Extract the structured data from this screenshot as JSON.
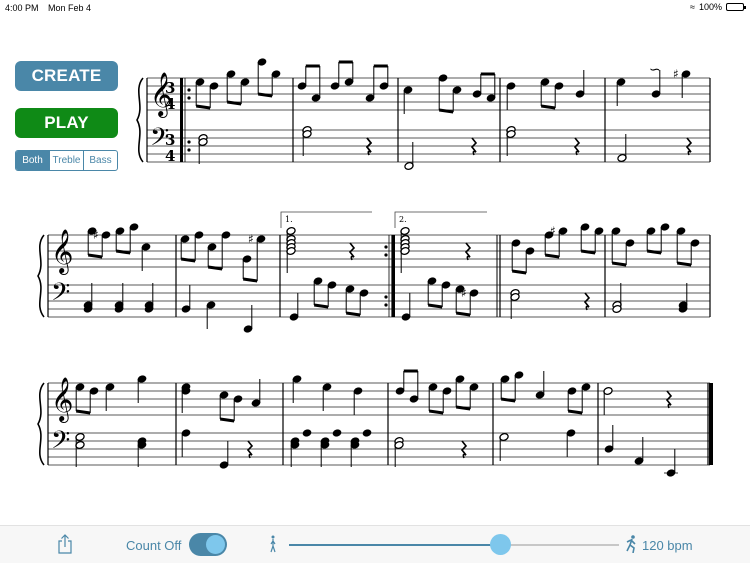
{
  "status_bar": {
    "time": "4:00 PM",
    "date": "Mon Feb 4",
    "battery": "100%"
  },
  "controls": {
    "create_label": "CREATE",
    "play_label": "PLAY",
    "hand_options": [
      "Both",
      "Treble",
      "Bass"
    ],
    "hand_selected": "Both"
  },
  "score": {
    "time_signature": "3/4",
    "clefs": [
      "treble",
      "bass"
    ],
    "ending_labels": [
      "1.",
      "2."
    ],
    "systems": [
      {
        "measures": 5,
        "notes": "repeat start; measures 1-5; trill/turn ornament in measure 5"
      },
      {
        "measures": 6,
        "notes": "measures 6-11 with first and second endings"
      },
      {
        "measures": 6,
        "notes": "measures 12-17; final barline"
      }
    ]
  },
  "toolbar": {
    "share_icon": "share-icon",
    "count_off_label": "Count Off",
    "count_off_enabled": true,
    "tempo_slider_fraction": 0.64,
    "tempo_label": "120 bpm",
    "slow_icon": "walk-icon",
    "fast_icon": "run-icon"
  },
  "colors": {
    "accent": "#4a87a8",
    "play": "#0f8a16",
    "knob": "#7ec7ec"
  }
}
